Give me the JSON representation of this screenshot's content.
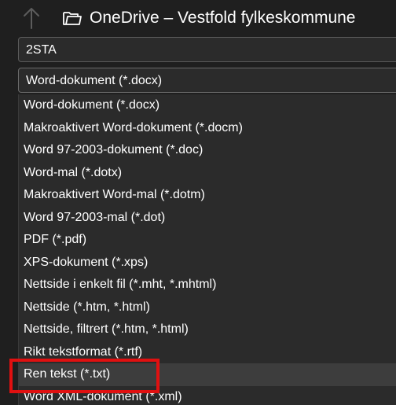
{
  "header": {
    "title": "OneDrive – Vestfold fylkeskommune",
    "icons": {
      "up": "up-arrow-icon",
      "folder": "folder-icon"
    }
  },
  "filename": {
    "value": "2STA"
  },
  "type_select": {
    "value": "Word-dokument (*.docx)"
  },
  "dropdown": {
    "options": [
      "Word-dokument (*.docx)",
      "Makroaktivert Word-dokument (*.docm)",
      "Word 97-2003-dokument (*.doc)",
      "Word-mal (*.dotx)",
      "Makroaktivert Word-mal (*.dotm)",
      "Word 97-2003-mal (*.dot)",
      "PDF (*.pdf)",
      "XPS-dokument (*.xps)",
      "Nettside i enkelt fil (*.mht, *.mhtml)",
      "Nettside (*.htm, *.html)",
      "Nettside, filtrert (*.htm, *.html)",
      "Rikt tekstformat (*.rtf)",
      "Ren tekst (*.txt)",
      "Word XML-dokument (*.xml)"
    ],
    "hovered_option": "Ren tekst (*.txt)"
  },
  "colors": {
    "background": "#1f1f1f",
    "field": "#2b2b2b",
    "hover": "#3d3d3d",
    "highlight_box": "#e01010"
  }
}
